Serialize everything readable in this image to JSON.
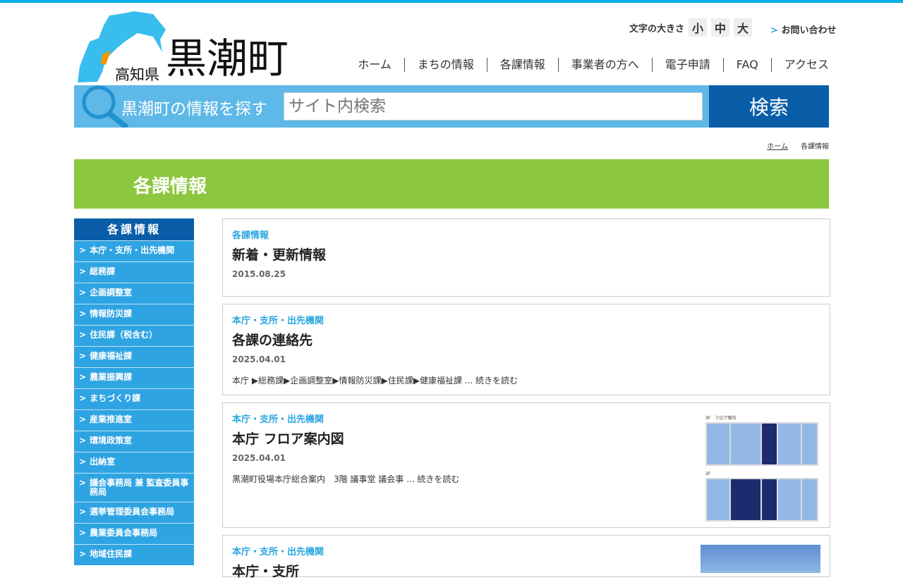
{
  "header": {
    "prefecture": "高知県",
    "town": "黒潮町",
    "font_size_label": "文字の大きさ",
    "font_sizes": [
      "小",
      "中",
      "大"
    ],
    "contact": "お問い合わせ",
    "contact_marker": ">"
  },
  "nav": [
    "ホーム",
    "まちの情報",
    "各課情報",
    "事業者の方へ",
    "電子申請",
    "FAQ",
    "アクセス"
  ],
  "search": {
    "label": "黒潮町の情報を探す",
    "placeholder": "サイト内検索",
    "button": "検索"
  },
  "breadcrumb": {
    "home": "ホーム",
    "current": "各課情報"
  },
  "banner": "各課情報",
  "sidebar": {
    "title": "各課情報",
    "marker": ">",
    "items": [
      "本庁・支所・出先機関",
      "総務課",
      "企画調整室",
      "情報防災課",
      "住民課（税含む）",
      "健康福祉課",
      "農業振興課",
      "まちづくり課",
      "産業推進室",
      "環境政策室",
      "出納室",
      "議会事務局 兼 監査委員事務局",
      "選挙管理委員会事務局",
      "農業委員会事務局",
      "地域住民課"
    ]
  },
  "cards": [
    {
      "category": "各課情報",
      "title": "新着・更新情報",
      "date": "2015.08.25"
    },
    {
      "category": "本庁・支所・出先機関",
      "title": "各課の連絡先",
      "date": "2025.04.01",
      "summary": "本庁 ▶総務課▶企画調整室▶情報防災課▶住民課▶健康福祉課 ... 続きを読む"
    },
    {
      "category": "本庁・支所・出先機関",
      "title": "本庁 フロア案内図",
      "date": "2025.04.01",
      "summary": "黒潮町役場本庁総合案内　3階 議事堂 議会事 ... 続きを読む",
      "floor3": "3F　フロア案内",
      "floor2": "2F"
    },
    {
      "category": "本庁・支所・出先機関",
      "title": "本庁・支所"
    }
  ],
  "colors": {
    "accent": "#2fa4e3",
    "navy": "#0a5ea8",
    "green": "#8dc63f"
  }
}
